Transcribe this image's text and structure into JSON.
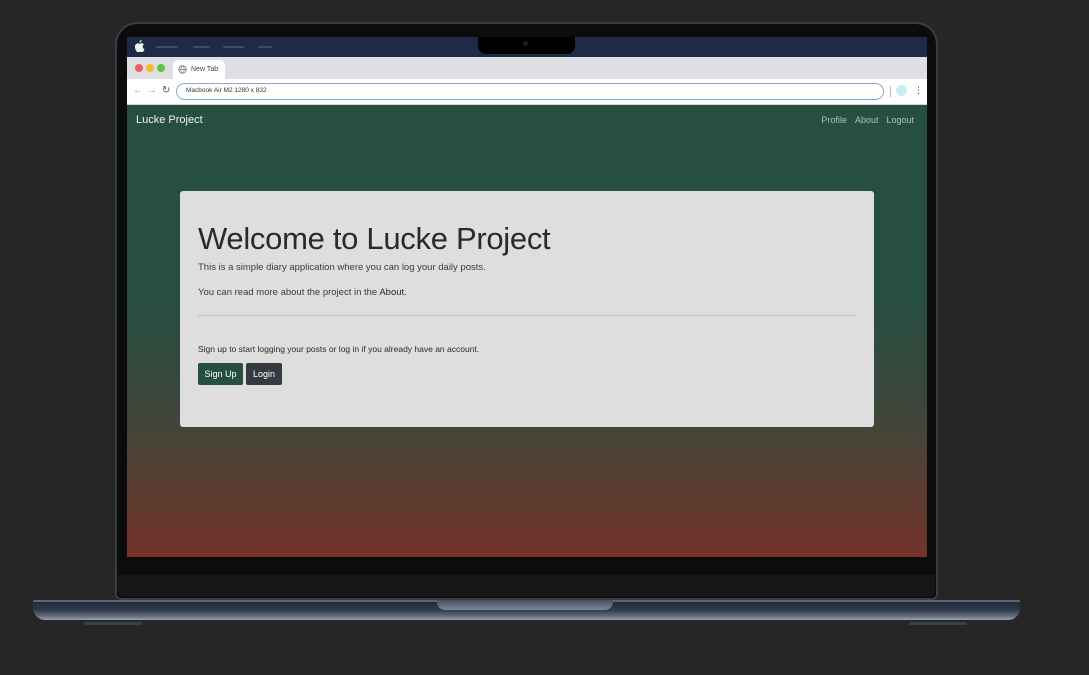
{
  "browser": {
    "tab_title": "New Tab",
    "address": "Macbook Air M2   1280 x 832",
    "icons": {
      "apple": "apple-icon",
      "tab": "globe-icon",
      "back": "back-arrow-icon",
      "forward": "forward-arrow-icon",
      "reload": "reload-icon",
      "menu": "kebab-menu-icon"
    },
    "traffic_colors": [
      "#ec5f57",
      "#f3bd2f",
      "#5ec443"
    ]
  },
  "navbar": {
    "brand": "Lucke Project",
    "links": [
      "Profile",
      "About",
      "Logout"
    ]
  },
  "hero": {
    "title": "Welcome to Lucke Project",
    "lead1": "This is a simple diary application where you can log your daily posts.",
    "lead2_prefix": "You can read more about the project in the ",
    "lead2_link": "About",
    "lead2_suffix": ".",
    "cta": "Sign up to start logging your posts or log in if you already have an account.",
    "signup_label": "Sign Up",
    "login_label": "Login"
  },
  "colors": {
    "primary": "#264e41",
    "dark_button": "#343a40",
    "gradient_bottom": "#74322a",
    "jumbotron": "#dedede"
  }
}
